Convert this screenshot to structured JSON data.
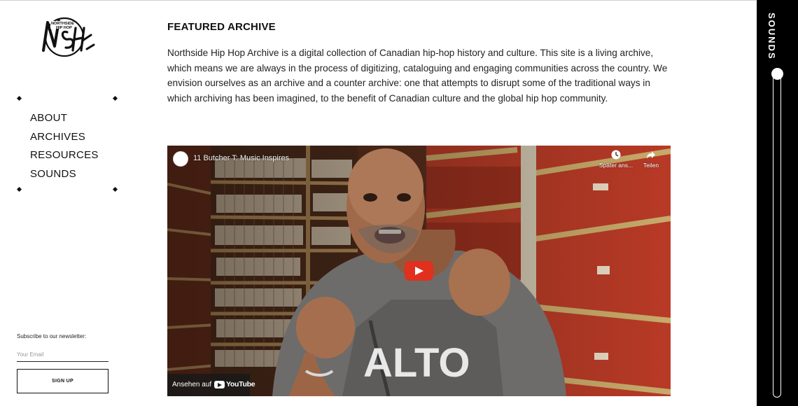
{
  "sidebar": {
    "nav": [
      "ABOUT",
      "ARCHIVES",
      "RESOURCES",
      "SOUNDS"
    ],
    "newsletter_label": "Subscribe to our newsletter:",
    "email_placeholder": "Your Email",
    "signup_label": "SIGN UP"
  },
  "main": {
    "title": "FEATURED ARCHIVE",
    "intro": "Northside Hip Hop Archive is a digital collection of Canadian hip-hop history and culture. This site is a living archive, which means we are always in the process of digitizing, cataloguing and engaging communities across the country. We envision ourselves as an archive and a counter archive: one that attempts to disrupt some of the traditional ways in which archiving has been imagined, to the benefit of Canadian culture and the global hip hop community."
  },
  "video": {
    "title": "11 Butcher T: Music Inspires",
    "watch_later": "Später ans...",
    "share": "Teilen",
    "watch_on": "Ansehen auf",
    "platform": "YouTube"
  },
  "sounds": {
    "label": "SOUNDS"
  },
  "colors": {
    "play_button": "#e0301e",
    "sounds_panel": "#000000",
    "shelf_red": "#b83a26"
  },
  "icons": [
    "logo-nshh",
    "clock-icon",
    "share-icon",
    "play-icon",
    "youtube-icon"
  ]
}
